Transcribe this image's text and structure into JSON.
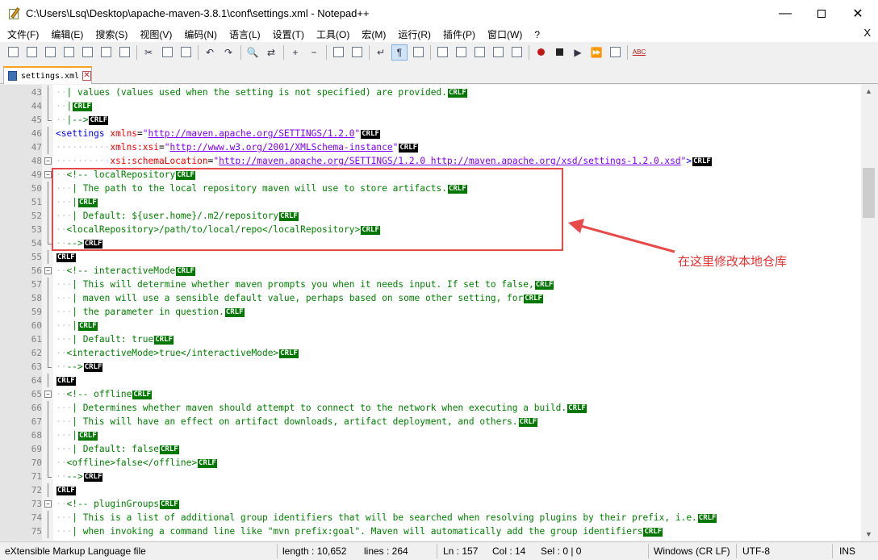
{
  "window": {
    "title": "C:\\Users\\Lsq\\Desktop\\apache-maven-3.8.1\\conf\\settings.xml - Notepad++",
    "minimize": "—",
    "close": "✕"
  },
  "menu": [
    "文件(F)",
    "编辑(E)",
    "搜索(S)",
    "视图(V)",
    "编码(N)",
    "语言(L)",
    "设置(T)",
    "工具(O)",
    "宏(M)",
    "运行(R)",
    "插件(P)",
    "窗口(W)",
    "?"
  ],
  "menu_close": "X",
  "toolbar": [
    "new-file-icon",
    "open-file-icon",
    "save-icon",
    "save-all-icon",
    "close-icon",
    "close-all-icon",
    "print-icon",
    "sep",
    "cut-icon",
    "copy-icon",
    "paste-icon",
    "sep",
    "undo-icon",
    "redo-icon",
    "sep",
    "find-icon",
    "replace-icon",
    "sep",
    "zoom-in-icon",
    "zoom-out-icon",
    "sep",
    "sync-v-icon",
    "sync-h-icon",
    "sep",
    "word-wrap-icon",
    "show-all-chars-icon",
    "indent-guide-icon",
    "sep",
    "udl-icon",
    "doc-map-icon",
    "function-list-icon",
    "folder-workspace-icon",
    "monitor-icon",
    "sep",
    "record-macro-icon",
    "stop-macro-icon",
    "play-macro-icon",
    "run-macro-multiple-icon",
    "save-macro-icon",
    "sep",
    "spell-check-icon"
  ],
  "tab": {
    "label": "settings.xml",
    "close": "✕"
  },
  "editor": {
    "lines": [
      {
        "n": "43",
        "fold": "",
        "parts": [
          [
            "ws",
            "··"
          ],
          [
            "cm",
            "| values (values used when the setting is not specified) are provided."
          ],
          [
            "crlf",
            "CRLF"
          ]
        ]
      },
      {
        "n": "44",
        "fold": "",
        "parts": [
          [
            "ws",
            "··"
          ],
          [
            "cm",
            "|"
          ],
          [
            "crlf",
            "CRLF"
          ]
        ]
      },
      {
        "n": "45",
        "fold": "end",
        "parts": [
          [
            "ws",
            "··"
          ],
          [
            "cm",
            "|-->"
          ],
          [
            "crlfbad",
            "CRLF"
          ]
        ]
      },
      {
        "n": "46",
        "fold": "",
        "parts": [
          [
            "tag",
            "<settings "
          ],
          [
            "attr",
            "xmlns"
          ],
          [
            "txt",
            "="
          ],
          [
            "str",
            "\""
          ],
          [
            "val",
            "http://maven.apache.org/SETTINGS/1.2.0"
          ],
          [
            "str",
            "\""
          ],
          [
            "crlfbad",
            "CRLF"
          ]
        ]
      },
      {
        "n": "47",
        "fold": "",
        "parts": [
          [
            "ws",
            "··········"
          ],
          [
            "attr",
            "xmlns:xsi"
          ],
          [
            "txt",
            "="
          ],
          [
            "str",
            "\""
          ],
          [
            "val",
            "http://www.w3.org/2001/XMLSchema-instance"
          ],
          [
            "str",
            "\""
          ],
          [
            "crlfbad",
            "CRLF"
          ]
        ]
      },
      {
        "n": "48",
        "fold": "box",
        "parts": [
          [
            "ws",
            "··········"
          ],
          [
            "attr",
            "xsi:schemaLocation"
          ],
          [
            "txt",
            "="
          ],
          [
            "str",
            "\""
          ],
          [
            "val",
            "http://maven.apache.org/SETTINGS/1.2.0 http://maven.apache.org/xsd/settings-1.2.0.xsd"
          ],
          [
            "str",
            "\""
          ],
          [
            "tag",
            ">"
          ],
          [
            "crlfbad",
            "CRLF"
          ]
        ]
      },
      {
        "n": "49",
        "fold": "box",
        "parts": [
          [
            "ws",
            "··"
          ],
          [
            "cm",
            "<!-- localRepository"
          ],
          [
            "crlf",
            "CRLF"
          ]
        ]
      },
      {
        "n": "50",
        "fold": "",
        "parts": [
          [
            "ws",
            "···"
          ],
          [
            "cm",
            "| The path to the local repository maven will use to store artifacts."
          ],
          [
            "crlf",
            "CRLF"
          ]
        ]
      },
      {
        "n": "51",
        "fold": "",
        "parts": [
          [
            "ws",
            "···"
          ],
          [
            "cm",
            "|"
          ],
          [
            "crlf",
            "CRLF"
          ]
        ]
      },
      {
        "n": "52",
        "fold": "",
        "parts": [
          [
            "ws",
            "···"
          ],
          [
            "cm",
            "| Default: ${user.home}/.m2/repository"
          ],
          [
            "crlf",
            "CRLF"
          ]
        ]
      },
      {
        "n": "53",
        "fold": "",
        "parts": [
          [
            "ws",
            "··"
          ],
          [
            "cm",
            "<localRepository>/path/to/local/repo</localRepository>"
          ],
          [
            "crlf",
            "CRLF"
          ]
        ]
      },
      {
        "n": "54",
        "fold": "end",
        "parts": [
          [
            "ws",
            "··"
          ],
          [
            "cm",
            "-->"
          ],
          [
            "crlfbad",
            "CRLF"
          ]
        ]
      },
      {
        "n": "55",
        "fold": "",
        "parts": [
          [
            "crlfbad",
            "CRLF"
          ]
        ]
      },
      {
        "n": "56",
        "fold": "box",
        "parts": [
          [
            "ws",
            "··"
          ],
          [
            "cm",
            "<!-- interactiveMode"
          ],
          [
            "crlf",
            "CRLF"
          ]
        ]
      },
      {
        "n": "57",
        "fold": "",
        "parts": [
          [
            "ws",
            "···"
          ],
          [
            "cm",
            "| This will determine whether maven prompts you when it needs input. If set to false,"
          ],
          [
            "crlf",
            "CRLF"
          ]
        ]
      },
      {
        "n": "58",
        "fold": "",
        "parts": [
          [
            "ws",
            "···"
          ],
          [
            "cm",
            "| maven will use a sensible default value, perhaps based on some other setting, for"
          ],
          [
            "crlf",
            "CRLF"
          ]
        ]
      },
      {
        "n": "59",
        "fold": "",
        "parts": [
          [
            "ws",
            "···"
          ],
          [
            "cm",
            "| the parameter in question."
          ],
          [
            "crlf",
            "CRLF"
          ]
        ]
      },
      {
        "n": "60",
        "fold": "",
        "parts": [
          [
            "ws",
            "···"
          ],
          [
            "cm",
            "|"
          ],
          [
            "crlf",
            "CRLF"
          ]
        ]
      },
      {
        "n": "61",
        "fold": "",
        "parts": [
          [
            "ws",
            "···"
          ],
          [
            "cm",
            "| Default: true"
          ],
          [
            "crlf",
            "CRLF"
          ]
        ]
      },
      {
        "n": "62",
        "fold": "",
        "parts": [
          [
            "ws",
            "··"
          ],
          [
            "cm",
            "<interactiveMode>true</interactiveMode>"
          ],
          [
            "crlf",
            "CRLF"
          ]
        ]
      },
      {
        "n": "63",
        "fold": "end",
        "parts": [
          [
            "ws",
            "··"
          ],
          [
            "cm",
            "-->"
          ],
          [
            "crlfbad",
            "CRLF"
          ]
        ]
      },
      {
        "n": "64",
        "fold": "",
        "parts": [
          [
            "crlfbad",
            "CRLF"
          ]
        ]
      },
      {
        "n": "65",
        "fold": "box",
        "parts": [
          [
            "ws",
            "··"
          ],
          [
            "cm",
            "<!-- offline"
          ],
          [
            "crlf",
            "CRLF"
          ]
        ]
      },
      {
        "n": "66",
        "fold": "",
        "parts": [
          [
            "ws",
            "···"
          ],
          [
            "cm",
            "| Determines whether maven should attempt to connect to the network when executing a build."
          ],
          [
            "crlf",
            "CRLF"
          ]
        ]
      },
      {
        "n": "67",
        "fold": "",
        "parts": [
          [
            "ws",
            "···"
          ],
          [
            "cm",
            "| This will have an effect on artifact downloads, artifact deployment, and others."
          ],
          [
            "crlf",
            "CRLF"
          ]
        ]
      },
      {
        "n": "68",
        "fold": "",
        "parts": [
          [
            "ws",
            "···"
          ],
          [
            "cm",
            "|"
          ],
          [
            "crlf",
            "CRLF"
          ]
        ]
      },
      {
        "n": "69",
        "fold": "",
        "parts": [
          [
            "ws",
            "···"
          ],
          [
            "cm",
            "| Default: false"
          ],
          [
            "crlf",
            "CRLF"
          ]
        ]
      },
      {
        "n": "70",
        "fold": "",
        "parts": [
          [
            "ws",
            "··"
          ],
          [
            "cm",
            "<offline>false</offline>"
          ],
          [
            "crlf",
            "CRLF"
          ]
        ]
      },
      {
        "n": "71",
        "fold": "end",
        "parts": [
          [
            "ws",
            "··"
          ],
          [
            "cm",
            "-->"
          ],
          [
            "crlfbad",
            "CRLF"
          ]
        ]
      },
      {
        "n": "72",
        "fold": "",
        "parts": [
          [
            "crlfbad",
            "CRLF"
          ]
        ]
      },
      {
        "n": "73",
        "fold": "box",
        "parts": [
          [
            "ws",
            "··"
          ],
          [
            "cm",
            "<!-- pluginGroups"
          ],
          [
            "crlf",
            "CRLF"
          ]
        ]
      },
      {
        "n": "74",
        "fold": "",
        "parts": [
          [
            "ws",
            "···"
          ],
          [
            "cm",
            "| This is a list of additional group identifiers that will be searched when resolving plugins by their prefix, i.e."
          ],
          [
            "crlf",
            "CRLF"
          ]
        ]
      },
      {
        "n": "75",
        "fold": "",
        "parts": [
          [
            "ws",
            "···"
          ],
          [
            "cm",
            "| when invoking a command line like \"mvn prefix:goal\". Maven will automatically add the group identifiers"
          ],
          [
            "crlf",
            "CRLF"
          ]
        ]
      }
    ]
  },
  "annotation": {
    "text": "在这里修改本地仓库",
    "color": "#e83030"
  },
  "status": {
    "file_type": "eXtensible Markup Language file",
    "length": "length : 10,652",
    "lines": "lines : 264",
    "ln": "Ln : 157",
    "col": "Col : 14",
    "sel": "Sel : 0 | 0",
    "eol": "Windows (CR LF)",
    "encoding": "UTF-8",
    "mode": "INS"
  }
}
